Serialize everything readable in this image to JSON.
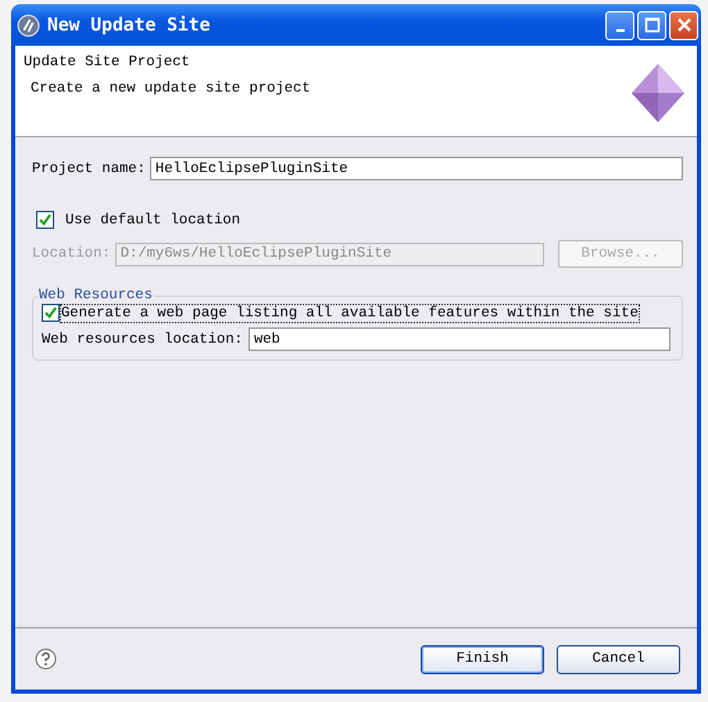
{
  "window": {
    "title": "New Update Site"
  },
  "header": {
    "title": "Update Site Project",
    "description": "Create a new update site project"
  },
  "project_name": {
    "label": "Project name:",
    "value": "HelloEclipsePluginSite"
  },
  "use_default_location": {
    "label": "Use default location",
    "checked": true
  },
  "location": {
    "label": "Location:",
    "value": "D:/my6ws/HelloEclipsePluginSite",
    "disabled": true,
    "browse": "Browse..."
  },
  "web_resources": {
    "title": "Web Resources",
    "generate": {
      "label": "Generate a web page listing all available features within the site",
      "checked": true
    },
    "location_label": "Web resources location:",
    "location_value": "web"
  },
  "buttons": [
    {
      "label": "Finish",
      "default": true
    },
    {
      "label": "Cancel",
      "default": false
    }
  ]
}
